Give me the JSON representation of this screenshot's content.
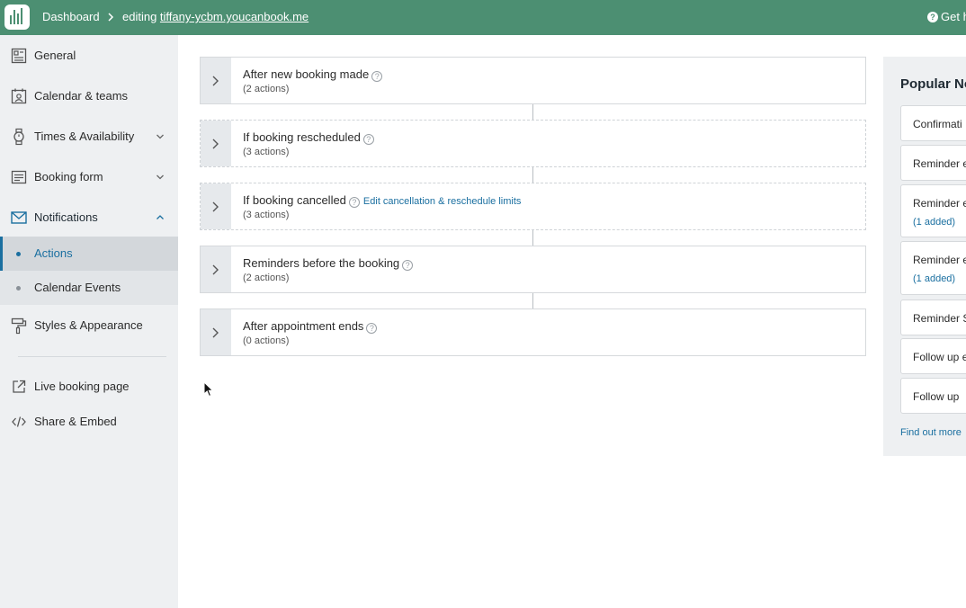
{
  "header": {
    "breadcrumb_dashboard": "Dashboard",
    "editing_prefix": "editing ",
    "site_name": "tiffany-ycbm.youcanbook.me",
    "help_label": "Get h"
  },
  "sidebar": {
    "items": [
      {
        "label": "General"
      },
      {
        "label": "Calendar & teams"
      },
      {
        "label": "Times & Availability"
      },
      {
        "label": "Booking form"
      },
      {
        "label": "Notifications"
      },
      {
        "label": "Styles & Appearance"
      },
      {
        "label": "Live booking page"
      },
      {
        "label": "Share & Embed"
      }
    ],
    "sub_items": [
      {
        "label": "Actions"
      },
      {
        "label": "Calendar Events"
      }
    ]
  },
  "actions": {
    "cards": [
      {
        "title": "After new booking made",
        "count": "(2 actions)"
      },
      {
        "title": "If booking rescheduled",
        "count": "(3 actions)"
      },
      {
        "title": "If booking cancelled",
        "count": "(3 actions)",
        "link": "Edit cancellation & reschedule limits"
      },
      {
        "title": "Reminders before the booking",
        "count": "(2 actions)"
      },
      {
        "title": "After appointment ends",
        "count": "(0 actions)"
      }
    ]
  },
  "popular": {
    "title": "Popular No",
    "items": [
      {
        "label": "Confirmati"
      },
      {
        "label": "Reminder e"
      },
      {
        "label": "Reminder e",
        "added": "(1 added)"
      },
      {
        "label": "Reminder e",
        "added": "(1 added)"
      },
      {
        "label": "Reminder S"
      },
      {
        "label": "Follow up e"
      },
      {
        "label": "Follow up"
      }
    ],
    "find_out_more": "Find out more"
  },
  "colors": {
    "topbar": "#4c8f72",
    "sidebar_bg": "#eef0f2",
    "accent_link": "#1a6fa0"
  }
}
